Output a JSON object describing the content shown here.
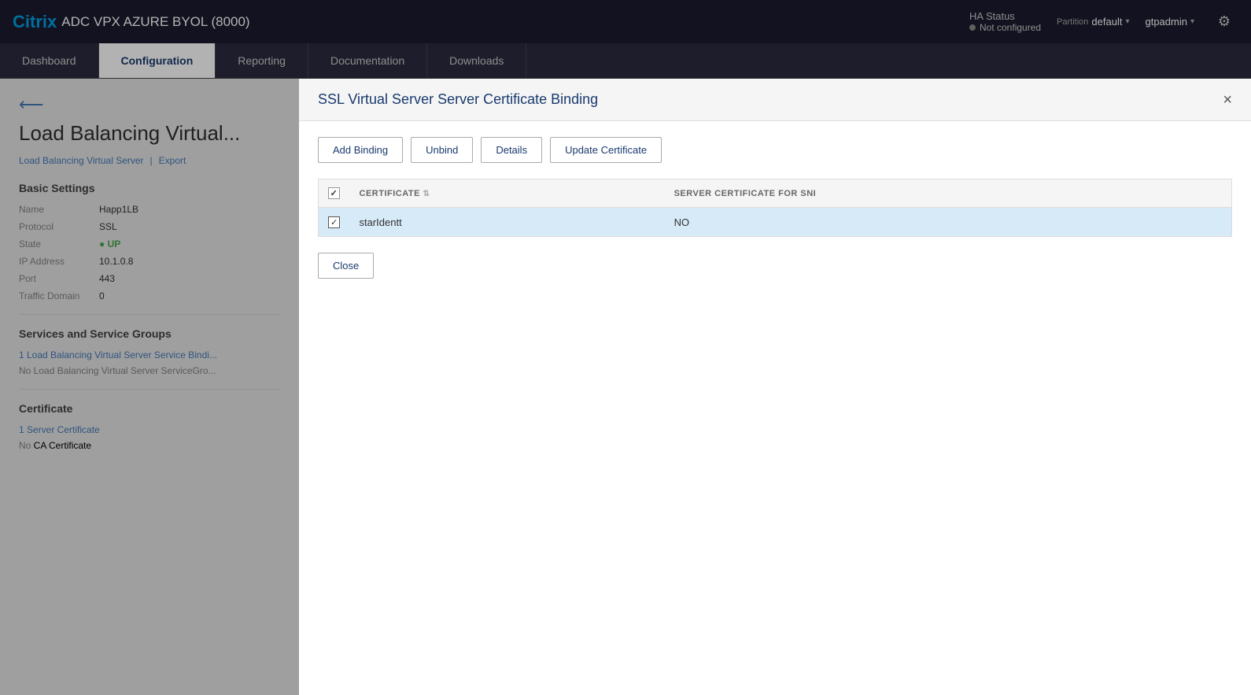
{
  "brand": {
    "citrix": "Citrix",
    "title": "ADC VPX AZURE BYOL (8000)"
  },
  "topbar": {
    "ha_status_label": "HA Status",
    "ha_status_value": "Not configured",
    "partition_label": "Partition",
    "partition_value": "default",
    "user": "gtpadmin"
  },
  "navbar": {
    "items": [
      {
        "id": "dashboard",
        "label": "Dashboard",
        "active": false
      },
      {
        "id": "configuration",
        "label": "Configuration",
        "active": true
      },
      {
        "id": "reporting",
        "label": "Reporting",
        "active": false
      },
      {
        "id": "documentation",
        "label": "Documentation",
        "active": false
      },
      {
        "id": "downloads",
        "label": "Downloads",
        "active": false
      }
    ]
  },
  "background": {
    "back_icon": "←",
    "page_title": "Load Balancing Virtual...",
    "breadcrumb_main": "Load Balancing Virtual Server",
    "breadcrumb_export": "Export",
    "basic_settings": "Basic Settings",
    "fields": [
      {
        "label": "Name",
        "value": "Happ1LB"
      },
      {
        "label": "Protocol",
        "value": "SSL"
      },
      {
        "label": "State",
        "value": "UP",
        "status": "up"
      },
      {
        "label": "IP Address",
        "value": "10.1.0.8"
      },
      {
        "label": "Port",
        "value": "443"
      },
      {
        "label": "Traffic Domain",
        "value": "0"
      }
    ],
    "services_section": "Services and Service Groups",
    "service_binding": "1 Load Balancing Virtual Server Service Bindi...",
    "service_group": "No Load Balancing Virtual Server ServiceGro...",
    "certificate_section": "Certificate",
    "server_cert": "1 Server Certificate",
    "ca_cert": "No CA Certificate"
  },
  "modal": {
    "title": "SSL Virtual Server Server Certificate Binding",
    "close_label": "×",
    "buttons": {
      "add_binding": "Add Binding",
      "unbind": "Unbind",
      "details": "Details",
      "update_certificate": "Update Certificate",
      "close": "Close"
    },
    "table": {
      "columns": [
        {
          "id": "checkbox",
          "label": ""
        },
        {
          "id": "certificate",
          "label": "CERTIFICATE",
          "sortable": true
        },
        {
          "id": "sni",
          "label": "SERVER CERTIFICATE FOR SNI"
        }
      ],
      "rows": [
        {
          "selected": true,
          "certificate": "starIdentt",
          "sni": "NO"
        }
      ]
    }
  }
}
